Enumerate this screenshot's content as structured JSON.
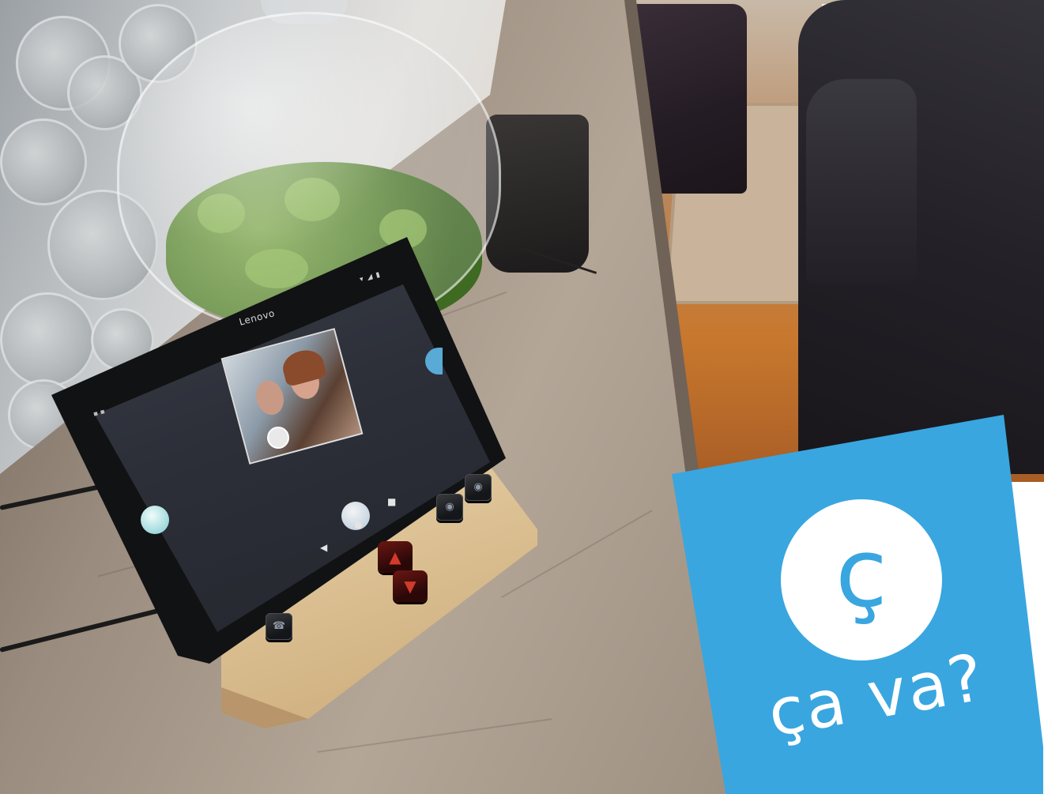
{
  "photo": {
    "description_elements": [
      "wall",
      "living-room",
      "table",
      "glass-cloche",
      "plant",
      "bag",
      "tablet",
      "wooden-stand",
      "badge"
    ]
  },
  "tablet": {
    "brand": "Lenovo"
  },
  "badge": {
    "logo_letter": "ç",
    "tagline": "ça va?",
    "color": "#39a6e0"
  },
  "keys": {
    "top_left_icon": "camera-icon",
    "top_right_icon": "camera-icon",
    "bottom_left_icon": "phone-icon",
    "arrow_up_icon": "triangle-up-icon",
    "arrow_down_icon": "triangle-down-icon"
  }
}
